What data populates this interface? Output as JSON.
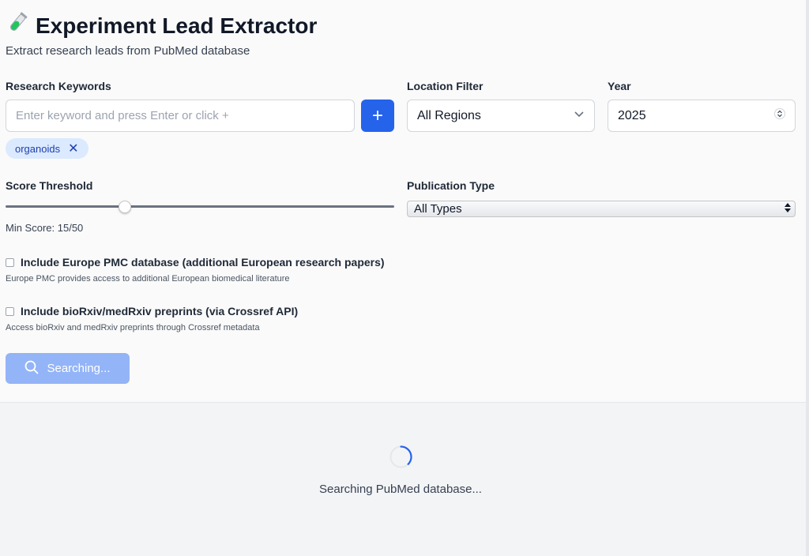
{
  "header": {
    "title": "Experiment Lead Extractor",
    "subtitle": "Extract research leads from PubMed database",
    "icon": "test-tube-icon"
  },
  "keywords": {
    "label": "Research Keywords",
    "placeholder": "Enter keyword and press Enter or click +",
    "value": "",
    "add_label": "+",
    "tags": [
      {
        "label": "organoids",
        "remove": "✕"
      }
    ]
  },
  "location": {
    "label": "Location Filter",
    "selected": "All Regions"
  },
  "year": {
    "label": "Year",
    "value": "2025"
  },
  "score": {
    "label": "Score Threshold",
    "min_score_text": "Min Score: 15/50",
    "value": 15,
    "max": 50
  },
  "publication_type": {
    "label": "Publication Type",
    "selected": "All Types"
  },
  "options": {
    "europe_pmc": {
      "label": "Include Europe PMC database (additional European research papers)",
      "help": "Europe PMC provides access to additional European biomedical literature",
      "checked": false
    },
    "biorxiv": {
      "label": "Include bioRxiv/medRxiv preprints (via Crossref API)",
      "help": "Access bioRxiv and medRxiv preprints through Crossref metadata",
      "checked": false
    }
  },
  "search_button": {
    "label": "Searching...",
    "icon": "search-icon"
  },
  "status": {
    "loading_text": "Searching PubMed database..."
  },
  "colors": {
    "primary": "#2563eb",
    "primary_disabled": "#93b4f7",
    "tag_bg": "#dbeafe",
    "tag_text": "#1e40af"
  }
}
